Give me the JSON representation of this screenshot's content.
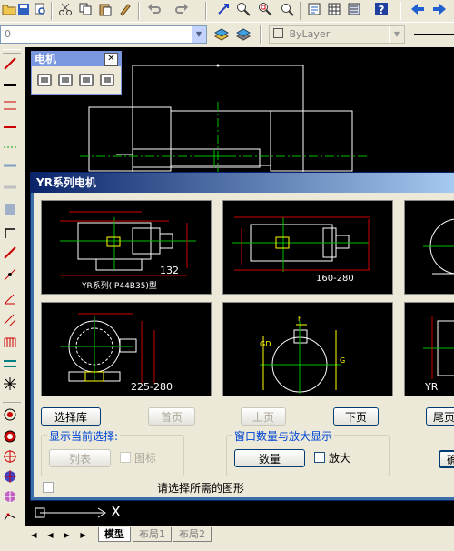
{
  "toolbar": {
    "color_combo": "0",
    "linetype_combo": "ByLayer"
  },
  "motor_palette": {
    "title": "电机"
  },
  "dialog": {
    "title": "YR系列电机",
    "thumbnails": [
      {
        "caption_top": "",
        "caption_bottom": "132",
        "caption_extra": "YR系列(IP44B35)型"
      },
      {
        "caption_top": "",
        "caption_bottom": "160-280",
        "caption_extra": ""
      },
      {
        "caption_top": "",
        "caption_bottom": "",
        "caption_extra": ""
      },
      {
        "caption_top": "",
        "caption_bottom": "225-280",
        "caption_extra": ""
      },
      {
        "caption_top": "",
        "caption_bottom": "",
        "caption_extra": ""
      },
      {
        "caption_top": "",
        "caption_bottom": "YR",
        "caption_extra": ""
      }
    ],
    "select_lib_button": "选择库",
    "first_page_button": "首页",
    "prev_page_button": "上页",
    "next_page_button": "下页",
    "last_page_button": "尾页",
    "current_select_group": "显示当前选择:",
    "list_button": "列表",
    "icon_checkbox_label": "图标",
    "window_group": "窗口数量与放大显示",
    "count_button": "数量",
    "zoom_checkbox_label": "放大",
    "confirm_button_partial": "确",
    "status_prompt": "请选择所需的图形"
  },
  "layout_tabs": [
    "模型",
    "布局1",
    "布局2"
  ],
  "ucs_label": "X"
}
